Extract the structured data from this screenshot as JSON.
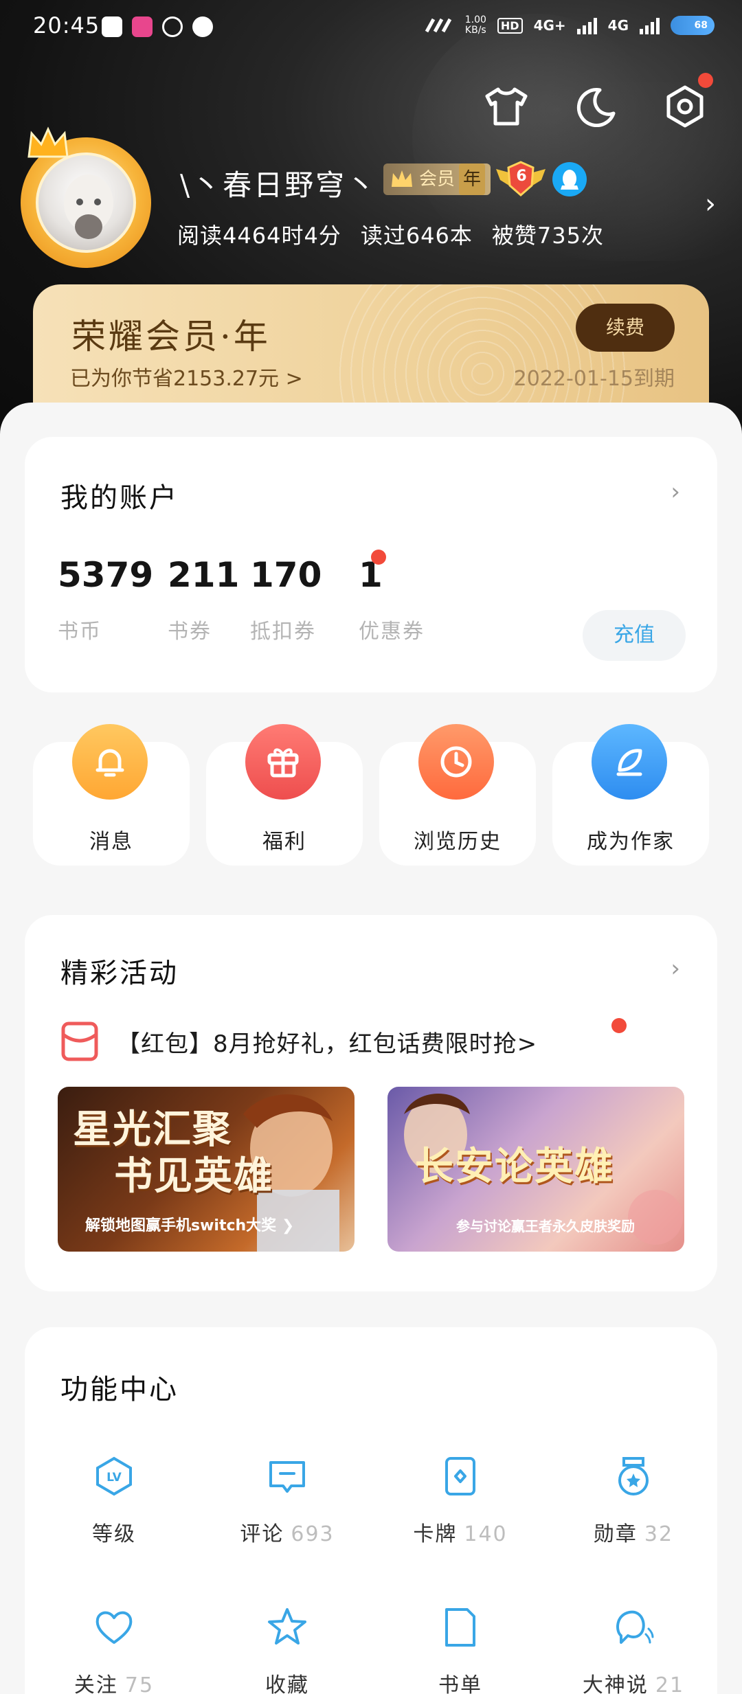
{
  "status_bar": {
    "time": "20:45",
    "net_speed_value": "1.00",
    "net_speed_unit": "KB/s",
    "hd": "HD",
    "network1": "4G+",
    "network2": "4G",
    "battery": "68"
  },
  "header_icons": [
    "shirt-icon",
    "moon-icon",
    "settings-icon"
  ],
  "profile": {
    "nickname": "\\丶春日野穹丶",
    "vip_label": "会员",
    "vip_year": "年",
    "level": "6",
    "reading_time": "阅读4464时4分",
    "books_read": "读过646本",
    "likes": "被赞735次"
  },
  "vip_card": {
    "title": "荣耀会员·年",
    "saved": "已为你节省2153.27元 >",
    "renew_label": "续费",
    "expire": "2022-01-15到期"
  },
  "account": {
    "title": "我的账户",
    "items": [
      {
        "value": "5379",
        "label": "书币"
      },
      {
        "value": "211",
        "label": "书券"
      },
      {
        "value": "170",
        "label": "抵扣券"
      },
      {
        "value": "1",
        "label": "优惠券"
      }
    ],
    "recharge_label": "充值"
  },
  "quick_actions": [
    {
      "label": "消息",
      "icon": "bell-icon",
      "color": "#ffb347"
    },
    {
      "label": "福利",
      "icon": "gift-icon",
      "color": "#f25e5e"
    },
    {
      "label": "浏览历史",
      "icon": "clock-icon",
      "color": "#ff7c4d"
    },
    {
      "label": "成为作家",
      "icon": "feather-icon",
      "color": "#3b98f5"
    }
  ],
  "events": {
    "title": "精彩活动",
    "promo_text": "【红包】8月抢好礼，红包话费限时抢>",
    "banners": [
      {
        "title_line1": "星光汇聚",
        "title_line2": "书见英雄",
        "subtitle": "解锁地图赢手机switch大奖"
      },
      {
        "title_line1": "长安论英雄",
        "title_line2": "",
        "subtitle": "参与讨论赢王者永久皮肤奖励"
      }
    ]
  },
  "features": {
    "title": "功能中心",
    "items": [
      {
        "label": "等级",
        "count": "",
        "icon": "level-icon"
      },
      {
        "label": "评论",
        "count": "693",
        "icon": "comment-icon"
      },
      {
        "label": "卡牌",
        "count": "140",
        "icon": "card-icon"
      },
      {
        "label": "勋章",
        "count": "32",
        "icon": "medal-icon"
      },
      {
        "label": "关注",
        "count": "75",
        "icon": "heart-icon"
      },
      {
        "label": "收藏",
        "count": "",
        "icon": "star-icon"
      },
      {
        "label": "书单",
        "count": "",
        "icon": "booklist-icon"
      },
      {
        "label": "大神说",
        "count": "21",
        "icon": "chat-icon"
      }
    ]
  },
  "colors": {
    "accent": "#39a6e6",
    "vip_gold": "#efd29b",
    "vip_brown": "#4f2e10",
    "red_dot": "#f24a3a"
  }
}
